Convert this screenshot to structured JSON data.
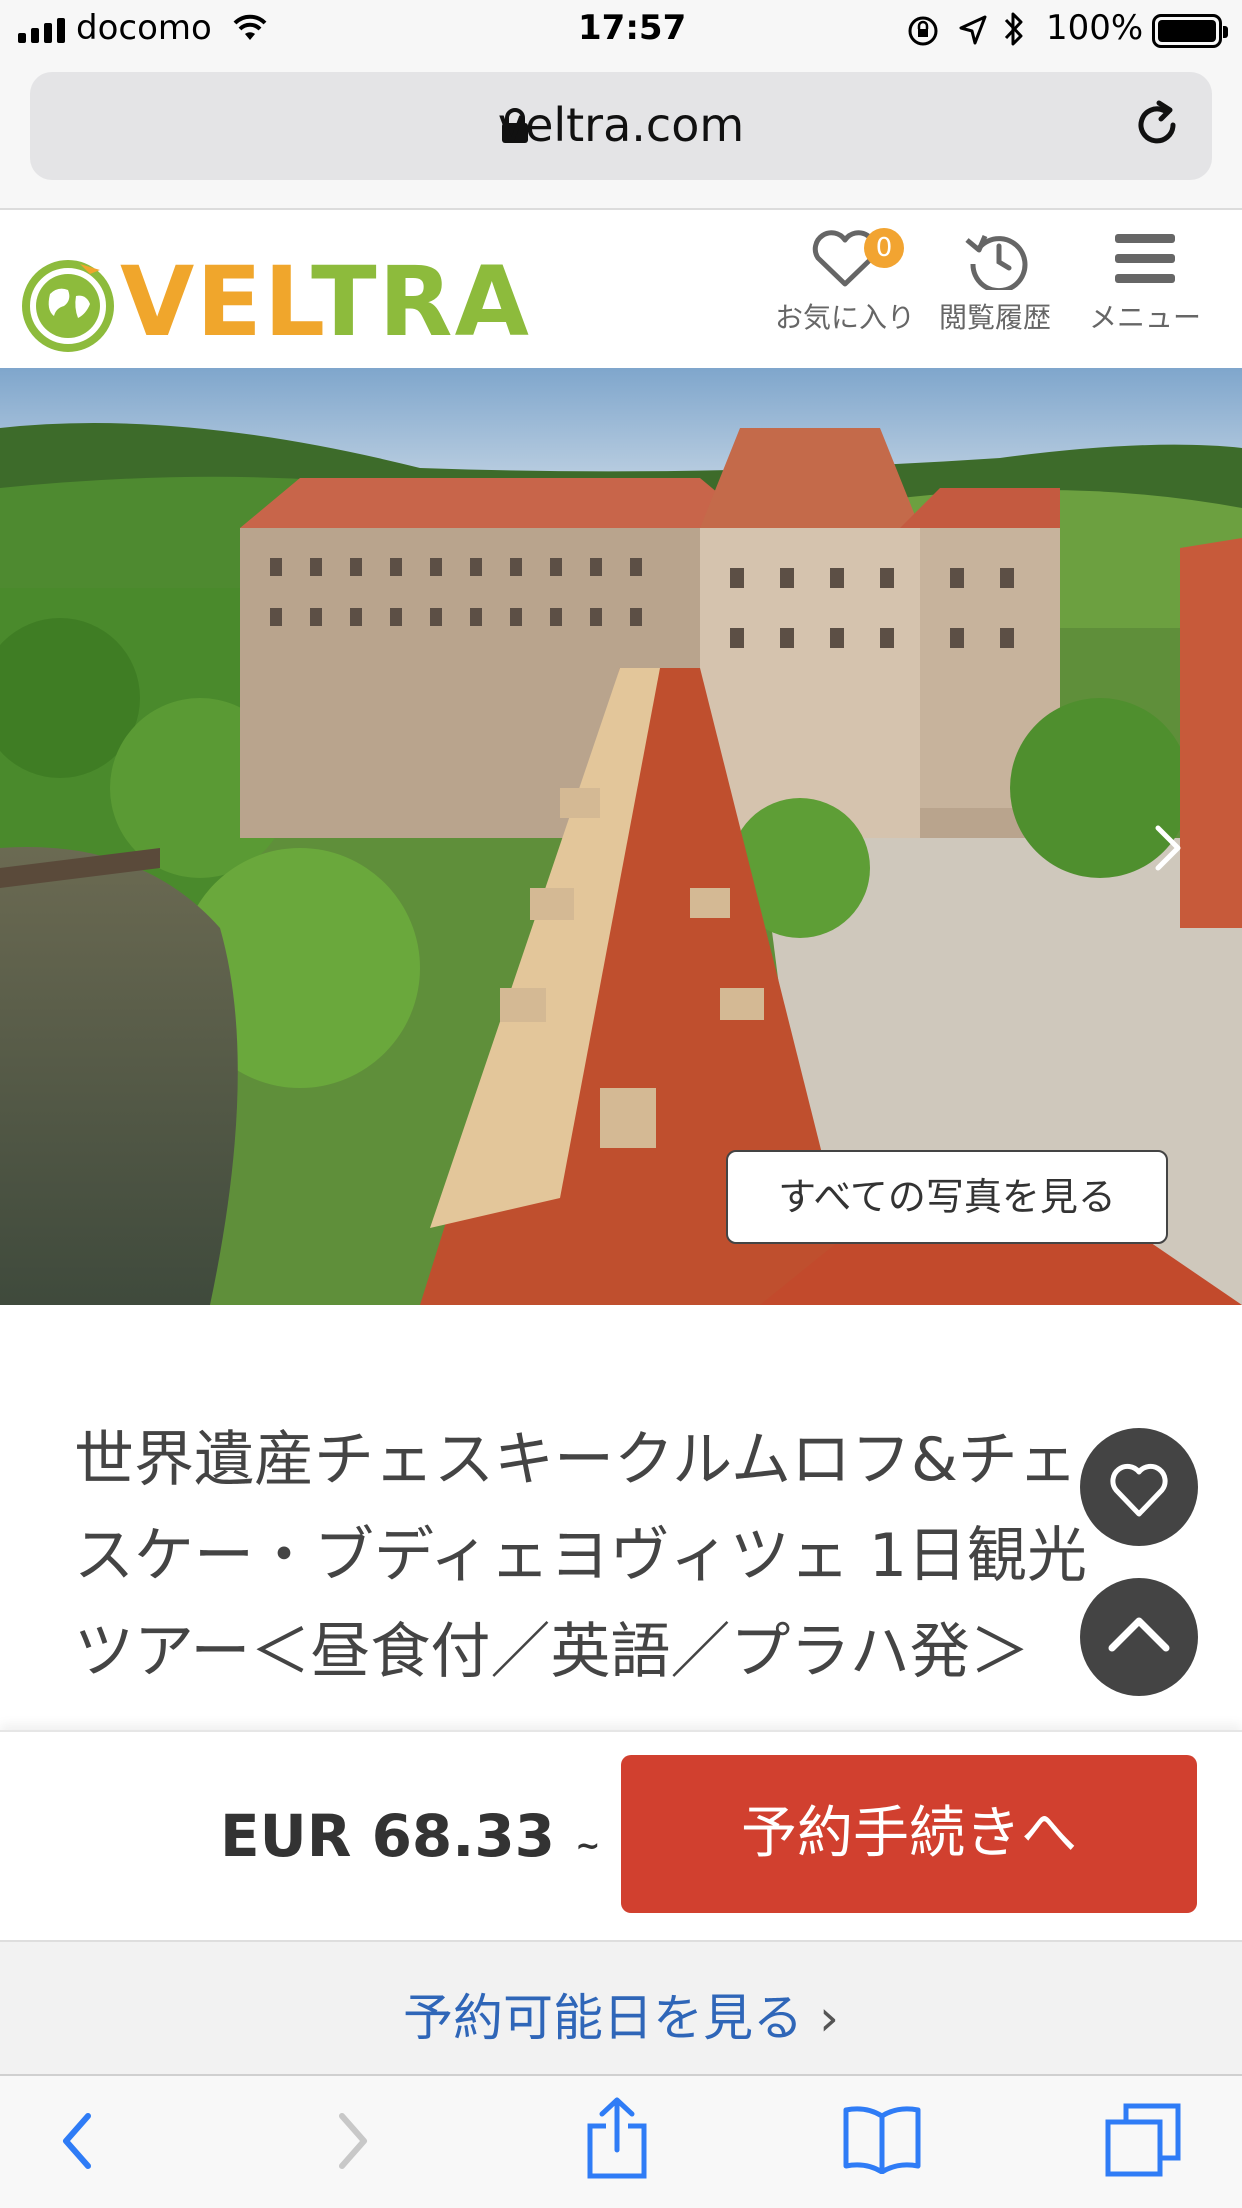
{
  "status_bar": {
    "carrier": "docomo",
    "time": "17:57",
    "battery": "100%"
  },
  "browser": {
    "url": "veltra.com"
  },
  "site_header": {
    "logo_text": "VELTRA",
    "favorites_label": "お気に入り",
    "favorites_count": "0",
    "history_label": "閲覧履歴",
    "menu_label": "メニュー"
  },
  "hero": {
    "view_all_photos": "すべての写真を見る"
  },
  "tour": {
    "title": "世界遺産チェスキークルムロフ&チェスケー・ブディェヨヴィツェ 1日観光ツアー＜昼食付／英語／プラハ発＞"
  },
  "booking": {
    "price": "EUR 68.33",
    "price_suffix": "~",
    "book_button": "予約手続きへ"
  },
  "availability": {
    "link": "予約可能日を見る",
    "chevron": "›"
  },
  "colors": {
    "brand_orange": "#f0a62c",
    "brand_green": "#8dbb3c",
    "book_red": "#d1402f",
    "link_blue": "#2f66b8",
    "ios_blue": "#2f7cf6"
  }
}
